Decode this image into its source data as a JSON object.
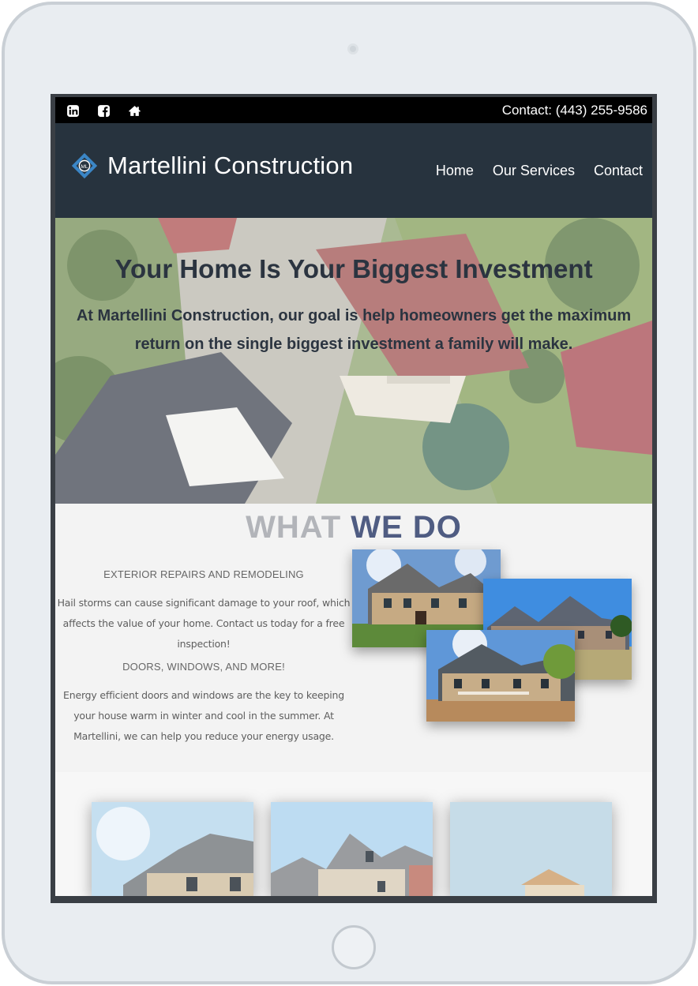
{
  "topbar": {
    "social_icons": [
      "linkedin-icon",
      "facebook-icon",
      "home-icon"
    ],
    "contact": "Contact: (443) 255-9586"
  },
  "header": {
    "brand": "Martellini Construction",
    "logo_text": "ML",
    "nav": [
      "Home",
      "Our Services",
      "Contact"
    ]
  },
  "hero": {
    "title": "Your Home Is Your Biggest Investment",
    "text": "At Martellini Construction, our goal is help homeowners get the maximum return on the single biggest investment a family will make."
  },
  "what_we_do": {
    "title_part1": "WHAT",
    "title_part2": "WE DO",
    "section1_heading": "EXTERIOR REPAIRS AND REMODELING",
    "section1_text": "Hail storms can cause significant damage to your roof, which affects the value of your home. Contact us today for a free inspection!",
    "section2_heading": "DOORS, WINDOWS, AND MORE!",
    "section2_text": "Energy efficient doors and windows are the key to keeping your house warm in winter and cool in the summer. At Martellini, we can help you reduce your energy usage."
  },
  "colors": {
    "topbar_bg": "#000000",
    "header_bg": "#27333e",
    "title_gray": "#b2b4b9",
    "title_blue": "#4f5c82",
    "logo_blue": "#3b86c6"
  }
}
